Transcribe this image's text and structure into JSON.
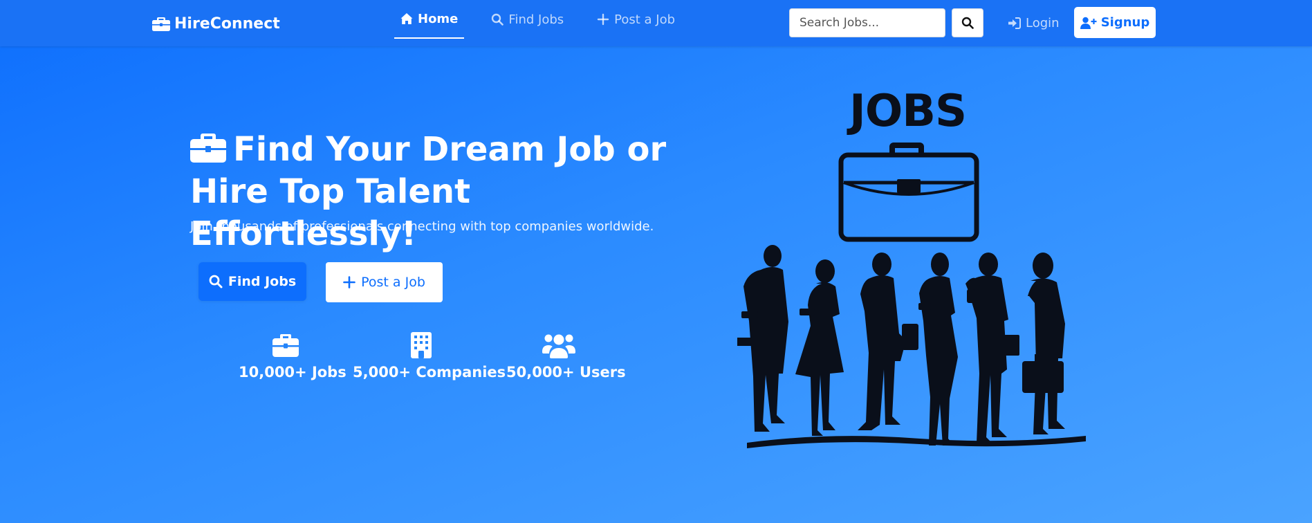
{
  "navbar": {
    "brand": "HireConnect",
    "links": [
      {
        "label": "Home",
        "icon": "home-icon",
        "active": true
      },
      {
        "label": "Find Jobs",
        "icon": "search-icon",
        "active": false
      },
      {
        "label": "Post a Job",
        "icon": "plus-icon",
        "active": false
      }
    ],
    "search_placeholder": "Search Jobs...",
    "login_label": "Login",
    "signup_label": "Signup"
  },
  "hero": {
    "title": "Find Your Dream Job or Hire Top Talent Effortlessly!",
    "subtitle": "Join thousands of professionals connecting with top companies worldwide.",
    "find_jobs_label": "Find Jobs",
    "post_job_label": "Post a Job",
    "stats": [
      {
        "label": "10,000+ Jobs",
        "icon": "briefcase-icon"
      },
      {
        "label": "5,000+ Companies",
        "icon": "building-icon"
      },
      {
        "label": "50,000+ Users",
        "icon": "users-icon"
      }
    ]
  },
  "illustration": {
    "word": "JOBS"
  },
  "colors": {
    "primary": "#0d6efd",
    "navbar": "#1a72f5",
    "white": "#ffffff",
    "silhouette": "#0a0f1a"
  }
}
